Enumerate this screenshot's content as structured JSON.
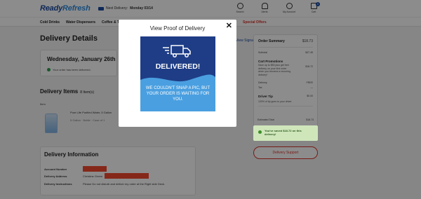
{
  "header": {
    "logo_main": "Ready",
    "logo_accent": "Refresh",
    "next_delivery_label": "Next Delivery:",
    "next_delivery_date": "Monday 03/14",
    "icons": [
      {
        "name": "search-icon",
        "label": "Search"
      },
      {
        "name": "bell-icon",
        "label": "Alerts"
      },
      {
        "name": "account-icon",
        "label": "My Account"
      },
      {
        "name": "cart-icon",
        "label": "Cart"
      }
    ],
    "cart_count": "0"
  },
  "nav": {
    "items": [
      "Cold Drinks",
      "Water Dispensers",
      "Coffee & Tea"
    ],
    "special": "Special Offers"
  },
  "page": {
    "title": "Delivery Details",
    "date_title": "Wednesday, January 26th",
    "date_status": "Your order has been delivered.",
    "items_title": "Delivery Items",
    "items_count": "8 Item(s)",
    "items_header": "Item",
    "product_name": "Pure Life Purified Water, 5 Gallon",
    "product_sub": "5 Gallon · Bottle · Case of 1",
    "view_signatures": "View Signatures"
  },
  "info": {
    "title": "Delivery Information",
    "rows": [
      {
        "key": "Account Number",
        "value": ""
      },
      {
        "key": "Delivery Address",
        "value": "Christine Green"
      },
      {
        "key": "Delivery Instructions",
        "value": "Please Do not disturb and deliver my order at the Right side Deck."
      }
    ]
  },
  "summary": {
    "title": "Order Summary",
    "total": "$18.73",
    "subtotal_label": "Subtotal",
    "subtotal": "$37.45",
    "promo_label": "Cart Promotions",
    "promo_text": "Save up to $50 plus get free delivery on your first order when you become a recurring delivery*",
    "promo_value": "$18.72",
    "delivery_label": "Delivery",
    "delivery_value": "FREE",
    "tax_label": "Tax",
    "tax_value": "—",
    "tip_label": "Driver Tip",
    "tip_value": "$0.00",
    "tip_sub": "100% of tip goes to your driver.",
    "estimated_label": "Estimated Total",
    "estimated_value": "$18.73",
    "saved_text": "You've saved $18.72 on this delivery!"
  },
  "support_button": "Delivery Support",
  "modal": {
    "title": "View Proof of Delivery",
    "close": "✕",
    "headline": "DELIVERED!",
    "message": "WE COULDN'T SNAP A PIC, BUT YOUR ORDER IS WAITING FOR YOU.",
    "colors": {
      "navy": "#1e3d86",
      "wave": "#4a9fe0"
    }
  }
}
